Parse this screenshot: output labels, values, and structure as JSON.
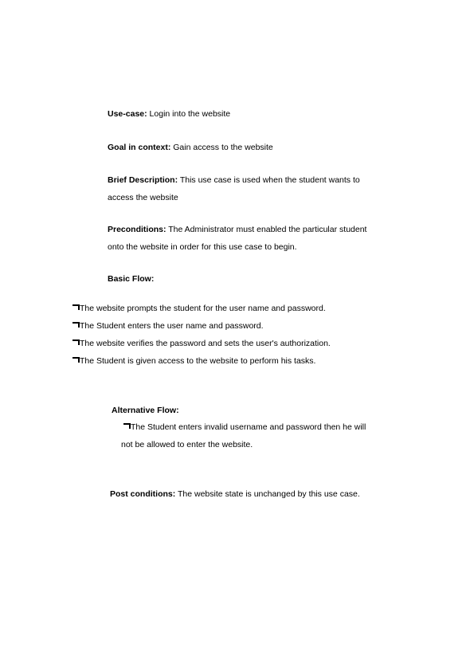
{
  "document": {
    "sections": {
      "use_case": {
        "label": "Use-case:",
        "value": "Login into the website"
      },
      "goal_in_context": {
        "label": "Goal in context:",
        "value": "Gain access to the website"
      },
      "brief_description": {
        "label": "Brief Description:",
        "line1": "This use case is used when the student wants to",
        "line2": "access the website"
      },
      "preconditions": {
        "label": "Preconditions:",
        "line1": "The Administrator  must enabled  the particular  student",
        "line2": "onto the website in order for this use case to begin."
      },
      "basic_flow": {
        "label": "Basic Flow:",
        "items": [
          "The website prompts the student for the user name and password.",
          "The Student enters the user name and password.",
          "The website verifies the password and sets the user's authorization.",
          "The Student is given access to the website to perform his tasks."
        ]
      },
      "alternative_flow": {
        "label": "Alternative Flow:",
        "item_line1": "The Student enters invalid username and password then he will",
        "item_line2": "not be allowed to enter the website."
      },
      "post_conditions": {
        "label": "Post conditions:",
        "value": "The website state is unchanged by this use case."
      }
    },
    "bullet_glyph": "missing-glyph-box"
  }
}
